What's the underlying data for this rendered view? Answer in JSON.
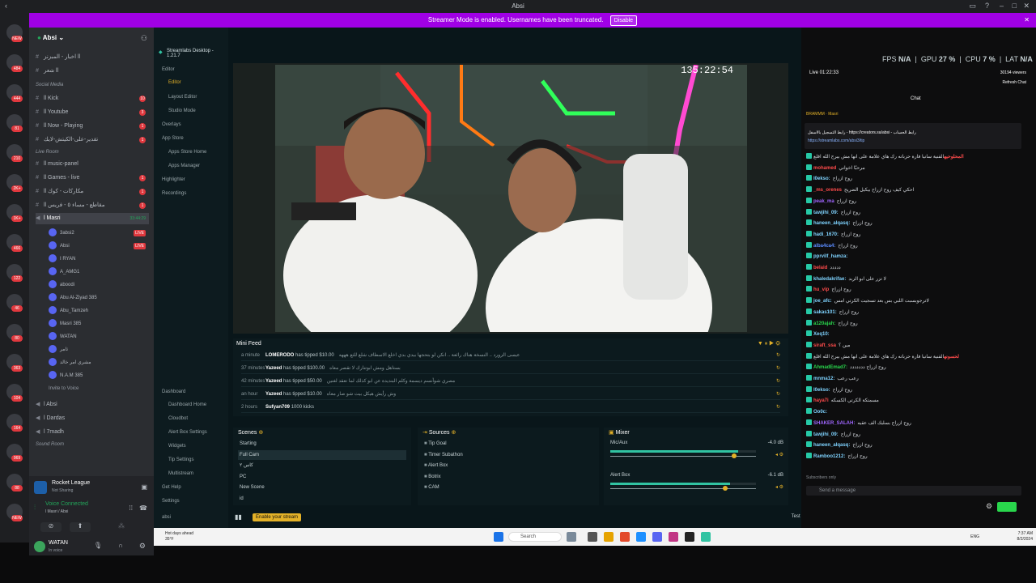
{
  "window": {
    "title": "Absi"
  },
  "banner": {
    "text": "Streamer Mode is enabled. Usernames have been truncated.",
    "button": "Disable"
  },
  "server_badges": [
    "NEW",
    "484",
    "444",
    "81",
    "210",
    "2K+",
    "1K+",
    "466",
    "122",
    "46",
    "80",
    "363",
    "104",
    "164",
    "969",
    "88",
    "NEW"
  ],
  "server": {
    "name": "Absi"
  },
  "channels": {
    "top": [
      {
        "name": "اخبار - المبز‌نز ll",
        "badge": ""
      },
      {
        "name": "شعر ll",
        "badge": ""
      }
    ],
    "social_label": "Social Media",
    "social": [
      {
        "name": "ll Kick",
        "badge": "10"
      },
      {
        "name": "ll Youtube",
        "badge": "3"
      },
      {
        "name": "ll Now - Playing",
        "badge": "1"
      },
      {
        "name": "تقدير-على-الكيتش-لايك",
        "badge": "1"
      }
    ],
    "live_label": "Live Room",
    "live": [
      {
        "name": "ll music-panel",
        "badge": ""
      },
      {
        "name": "ll Games - live",
        "badge": "1"
      },
      {
        "name": "ll مكاركات - كوك",
        "badge": "1"
      },
      {
        "name": "ll مقاطع - مساء ٥ - فريس",
        "badge": "1"
      }
    ],
    "voice_channel": {
      "name": "l Masri",
      "time": "33:44:29"
    },
    "voice_users": [
      {
        "name": "3absi2",
        "live": "LIVE"
      },
      {
        "name": "Absi",
        "live": "LIVE"
      },
      {
        "name": "I RYAN",
        "live": ""
      },
      {
        "name": "A_AMG1",
        "live": ""
      },
      {
        "name": "aboodi",
        "live": ""
      },
      {
        "name": "Abu Al-Ziyad 385",
        "live": ""
      },
      {
        "name": "Abu_Tamzeh",
        "live": ""
      },
      {
        "name": "Masri 385",
        "live": ""
      },
      {
        "name": "WATAN",
        "live": ""
      },
      {
        "name": "ثامر",
        "live": ""
      },
      {
        "name": "مشري امر خالد",
        "live": ""
      },
      {
        "name": "N.A.M 385",
        "live": ""
      }
    ],
    "invite": "Invite to Voice",
    "bottom": [
      {
        "name": "l Absi"
      },
      {
        "name": "l Dardas"
      },
      {
        "name": "l 7madh"
      }
    ],
    "sound_label": "Sound Room"
  },
  "activity": {
    "game": "Rocket League",
    "status": "Not Sharing"
  },
  "voice": {
    "status": "Voice Connected",
    "channel": "l Masri / Absi"
  },
  "user": {
    "name": "WATAN",
    "status": "In voice"
  },
  "streamlabs": {
    "app_title": "Streamlabs Desktop - 1.21.7",
    "nav": [
      "Editor",
      "Editor",
      "Layout Editor",
      "Studio Mode",
      "Overlays",
      "App Store",
      "Apps Store Home",
      "Apps Manager",
      "Highlighter",
      "Recordings"
    ],
    "nav_bottom": [
      "Dashboard",
      "Dashboard Home",
      "Cloudbot",
      "Alert Box Settings",
      "Widgets",
      "Tip Settings",
      "Multistream",
      "Get Help",
      "Settings",
      "absi"
    ],
    "timer": "135:22:54",
    "perf": {
      "fps_label": "FPS",
      "fps": "N/A",
      "gpu_label": "GPU",
      "gpu": "27 %",
      "cpu_label": "CPU",
      "cpu": "7 %",
      "lat_label": "LAT",
      "lat": "N/A"
    },
    "live_time": "Live 01:22:33",
    "viewers": "30194 viewers",
    "refresh": "Refresh Chat",
    "chat_title": "Chat",
    "minifeed": {
      "title": "Mini Feed",
      "rows": [
        {
          "time": "a minute",
          "name": "LOMERODO",
          "action": "has tipped $10.00",
          "msg": "عيسى الزورد .. النسخة هناك رائعة .. انكن لو بتحجها بيدي بدي اخلع الاسطاف شلع للثع هههه"
        },
        {
          "time": "37 minutes",
          "name": "Yazeed",
          "action": "has tipped $100.00",
          "msg": "بستاهل ومش ابوتنارك لا تقصر معاه"
        },
        {
          "time": "42 minutes",
          "name": "Yazeed",
          "action": "has tipped $50.00",
          "msg": "مصري شوأنسم ديسمة وكلم البنديدة عن ابو كذلك لما تعقد لغنين"
        },
        {
          "time": "an hour",
          "name": "Yazeed",
          "action": "has tipped $10.00",
          "msg": "وش رأيش هيكل بيت شو صار معاه"
        },
        {
          "time": "2 hours",
          "name": "Sufyan709",
          "action": "1000 kicks",
          "msg": ""
        }
      ]
    },
    "scenes": {
      "title": "Scenes",
      "items": [
        "Starting",
        "Full Cam",
        "كاس ٢",
        "PC",
        "New Scene",
        "id"
      ]
    },
    "sources": {
      "title": "Sources",
      "items": [
        "Tip Goal",
        "Timer Subathon",
        "Alert Box",
        "Botrix",
        "CAM"
      ]
    },
    "mixer": {
      "title": "Mixer",
      "items": [
        {
          "name": "Mic/Aux",
          "db": "-4.0 dB",
          "level": 0.88
        },
        {
          "name": "Alert Box",
          "db": "-6.1 dB",
          "level": 0.82
        }
      ]
    },
    "go_live": "Enable your stream",
    "test_widgets": "Test Widgets",
    "chat": {
      "pinned_user": "BRAMMM  ·  Masri",
      "pinned_text": "رابط التسجيل بالاسفل - https://creators.sa/absi - رابط الحساب",
      "pinned_link": "https://streamlabs.com/absi3/tip",
      "messages": [
        {
          "user": "المحلوحيه",
          "text": "القنية سانيا فارة حزباته رك هاي علامة على انها مش بيرج الله اقلع",
          "color": "#ff4b4b"
        },
        {
          "user": "mohamed",
          "text": "مرحبًا اخواني",
          "color": "#ff4b4b"
        },
        {
          "user": "l0ekso:",
          "text": "روح ازراح",
          "color": "#7fd3ff"
        },
        {
          "user": "_ms_orenes",
          "text": "احكي كيف روح ازراح بيكيل الضريح",
          "color": "#ff4b4b"
        },
        {
          "user": "peak_ma",
          "text": "روح ازراح",
          "color": "#a066ff"
        },
        {
          "user": "tawjihi_09:",
          "text": "روح ازراح",
          "color": "#7fd3ff"
        },
        {
          "user": "haneen_alqasq:",
          "text": "روح ازراح",
          "color": "#7fd3ff"
        },
        {
          "user": "hadi_1670:",
          "text": "روح ازراح",
          "color": "#7fd3ff"
        },
        {
          "user": "alba4ca4:",
          "text": "روح ازراح",
          "color": "#5b8cff"
        },
        {
          "user": "pprvilf_hamza:",
          "text": "",
          "color": "#7fd3ff"
        },
        {
          "user": "belaid",
          "text": "ددددد",
          "color": "#ff4b4b"
        },
        {
          "user": "khaledakrifae:",
          "text": "لا تزر على ابو الزبد",
          "color": "#7fd3ff"
        },
        {
          "user": "hu_vip",
          "text": "روح ازراح",
          "color": "#ff4b4b"
        },
        {
          "user": "joe_afc:",
          "text": "لاترجوبسبت اللبي بس بعد تسجيت الكرتي امس",
          "color": "#7fd3ff"
        },
        {
          "user": "sakas101:",
          "text": "روح ازراح",
          "color": "#7fd3ff"
        },
        {
          "user": "a120ajah:",
          "text": "روح ازراح",
          "color": "#29d64c"
        },
        {
          "user": "Xeq10:",
          "text": "",
          "color": "#7fd3ff"
        },
        {
          "user": "siraft_ssa",
          "text": "مين ؟",
          "color": "#ff4b4b"
        },
        {
          "user": "لحسونه",
          "text": "القنية سانيا فارة حزباته رك هاي علامة على انها مش بيرج الله اقلع",
          "color": "#ff4b4b"
        },
        {
          "user": "AhmadEmad7:",
          "text": "روح ازراح ددددددد",
          "color": "#29d64c"
        },
        {
          "user": "mnma12:",
          "text": "رعب رعب",
          "color": "#7fd3ff"
        },
        {
          "user": "l0ekso:",
          "text": "روح ازراح",
          "color": "#7fd3ff"
        },
        {
          "user": "haya7i",
          "text": "مسمتكة الكرتي الكسكه",
          "color": "#ff4b4b"
        },
        {
          "user": "Oo0c:",
          "text": "",
          "color": "#7fd3ff"
        },
        {
          "user": "SHAKER_SALAH:",
          "text": "روح ازراح بسليك الف عقيه",
          "color": "#a066ff"
        },
        {
          "user": "tawjihi_09:",
          "text": "روح ازراح",
          "color": "#7fd3ff"
        },
        {
          "user": "haneen_alqasq:",
          "text": "روح ازراح",
          "color": "#7fd3ff"
        },
        {
          "user": "Ramboo1212:",
          "text": "روح ازراح",
          "color": "#7fd3ff"
        }
      ],
      "subscribers_only": "Subscribers only",
      "placeholder": "Send a message"
    }
  },
  "taskbar": {
    "weather_title": "Hot days ahead",
    "weather_sub": "35°F",
    "search": "Search",
    "time": "7:37 AM",
    "date": "8/2/2024",
    "lang": "ENG"
  },
  "colors": {
    "accent_purple": "#a000e5",
    "live_red": "#e0383e",
    "voice_green": "#23a55a",
    "streamlabs_teal": "#31c3a2"
  }
}
